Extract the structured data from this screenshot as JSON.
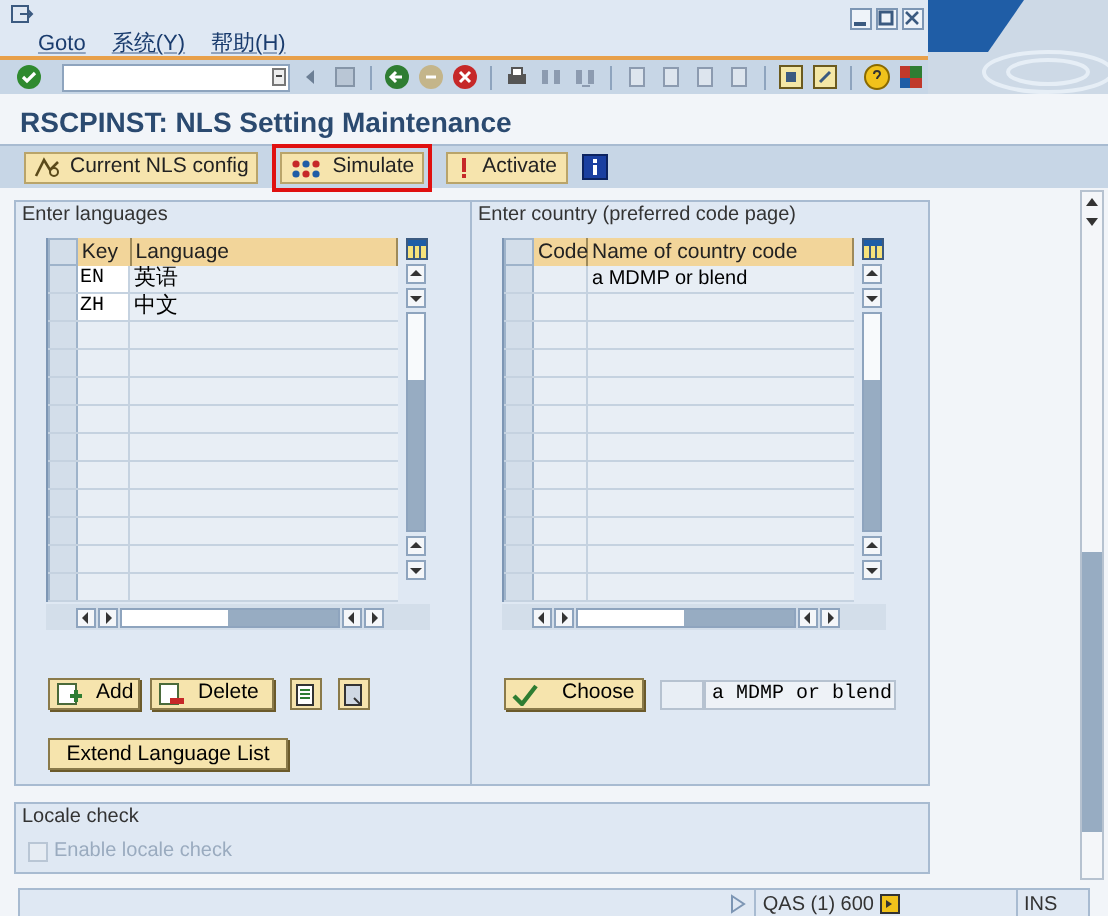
{
  "menu": [
    {
      "label": "Goto"
    },
    {
      "label": "系统(Y)"
    },
    {
      "label": "帮助(H)"
    }
  ],
  "title": "RSCPINST: NLS Setting Maintenance",
  "app_toolbar": [
    {
      "label": "Current NLS config",
      "highlighted": false
    },
    {
      "label": "Simulate",
      "highlighted": true
    },
    {
      "label": "Activate",
      "highlighted": false
    }
  ],
  "languages": {
    "title": "Enter languages",
    "columns": [
      "Key",
      "Language"
    ],
    "rows": [
      {
        "key": "EN",
        "language": "英语"
      },
      {
        "key": "ZH",
        "language": "中文"
      }
    ],
    "buttons": [
      "Add",
      "Delete"
    ],
    "extend_button": "Extend Language List"
  },
  "country": {
    "title": "Enter country (preferred code page)",
    "columns": [
      "Code",
      "Name of country code"
    ],
    "rows": [
      {
        "name": "a MDMP or blend"
      }
    ],
    "choose_button": "Choose",
    "field_value": "a MDMP or blend"
  },
  "locale_check": {
    "title": "Locale check",
    "checkbox": {
      "label": "Enable locale check",
      "checked": false,
      "disabled": true
    }
  },
  "status_bar": {
    "system": "QAS (1) 600",
    "mode": "INS"
  }
}
